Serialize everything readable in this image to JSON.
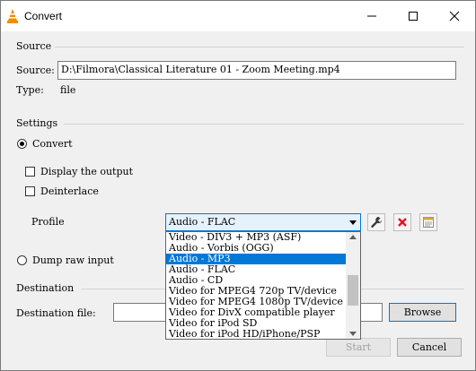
{
  "window": {
    "title": "Convert"
  },
  "source": {
    "group_label": "Source",
    "source_label": "Source:",
    "source_value": "D:\\Filmora\\Classical Literature 01 - Zoom Meeting.mp4",
    "type_label": "Type:",
    "type_value": "file"
  },
  "settings": {
    "group_label": "Settings",
    "convert_label": "Convert",
    "display_output_label": "Display the output",
    "deinterlace_label": "Deinterlace",
    "profile_label": "Profile",
    "profile_selected": "Audio - FLAC",
    "dump_raw_label": "Dump raw input"
  },
  "profile_options": [
    {
      "label": "Video - DIV3 + MP3 (ASF)"
    },
    {
      "label": "Audio - Vorbis (OGG)"
    },
    {
      "label": "Audio - MP3"
    },
    {
      "label": "Audio - FLAC"
    },
    {
      "label": "Audio - CD"
    },
    {
      "label": "Video for MPEG4 720p TV/device"
    },
    {
      "label": "Video for MPEG4 1080p TV/device"
    },
    {
      "label": "Video for DivX compatible player"
    },
    {
      "label": "Video for iPod SD"
    },
    {
      "label": "Video for iPod HD/iPhone/PSP"
    }
  ],
  "highlighted_option": "Audio - MP3",
  "destination": {
    "group_label": "Destination",
    "file_label": "Destination file:",
    "file_value": "",
    "browse_label": "Browse"
  },
  "buttons": {
    "start_label": "Start",
    "cancel_label": "Cancel"
  },
  "icons": {
    "edit_profile": "wrench-icon",
    "delete_profile": "red-x-icon",
    "new_profile": "new-profile-icon",
    "app": "vlc-cone-icon"
  },
  "colors": {
    "selection": "#0078d7",
    "delete_red": "#e81123",
    "vlc_orange": "#f58a07"
  }
}
